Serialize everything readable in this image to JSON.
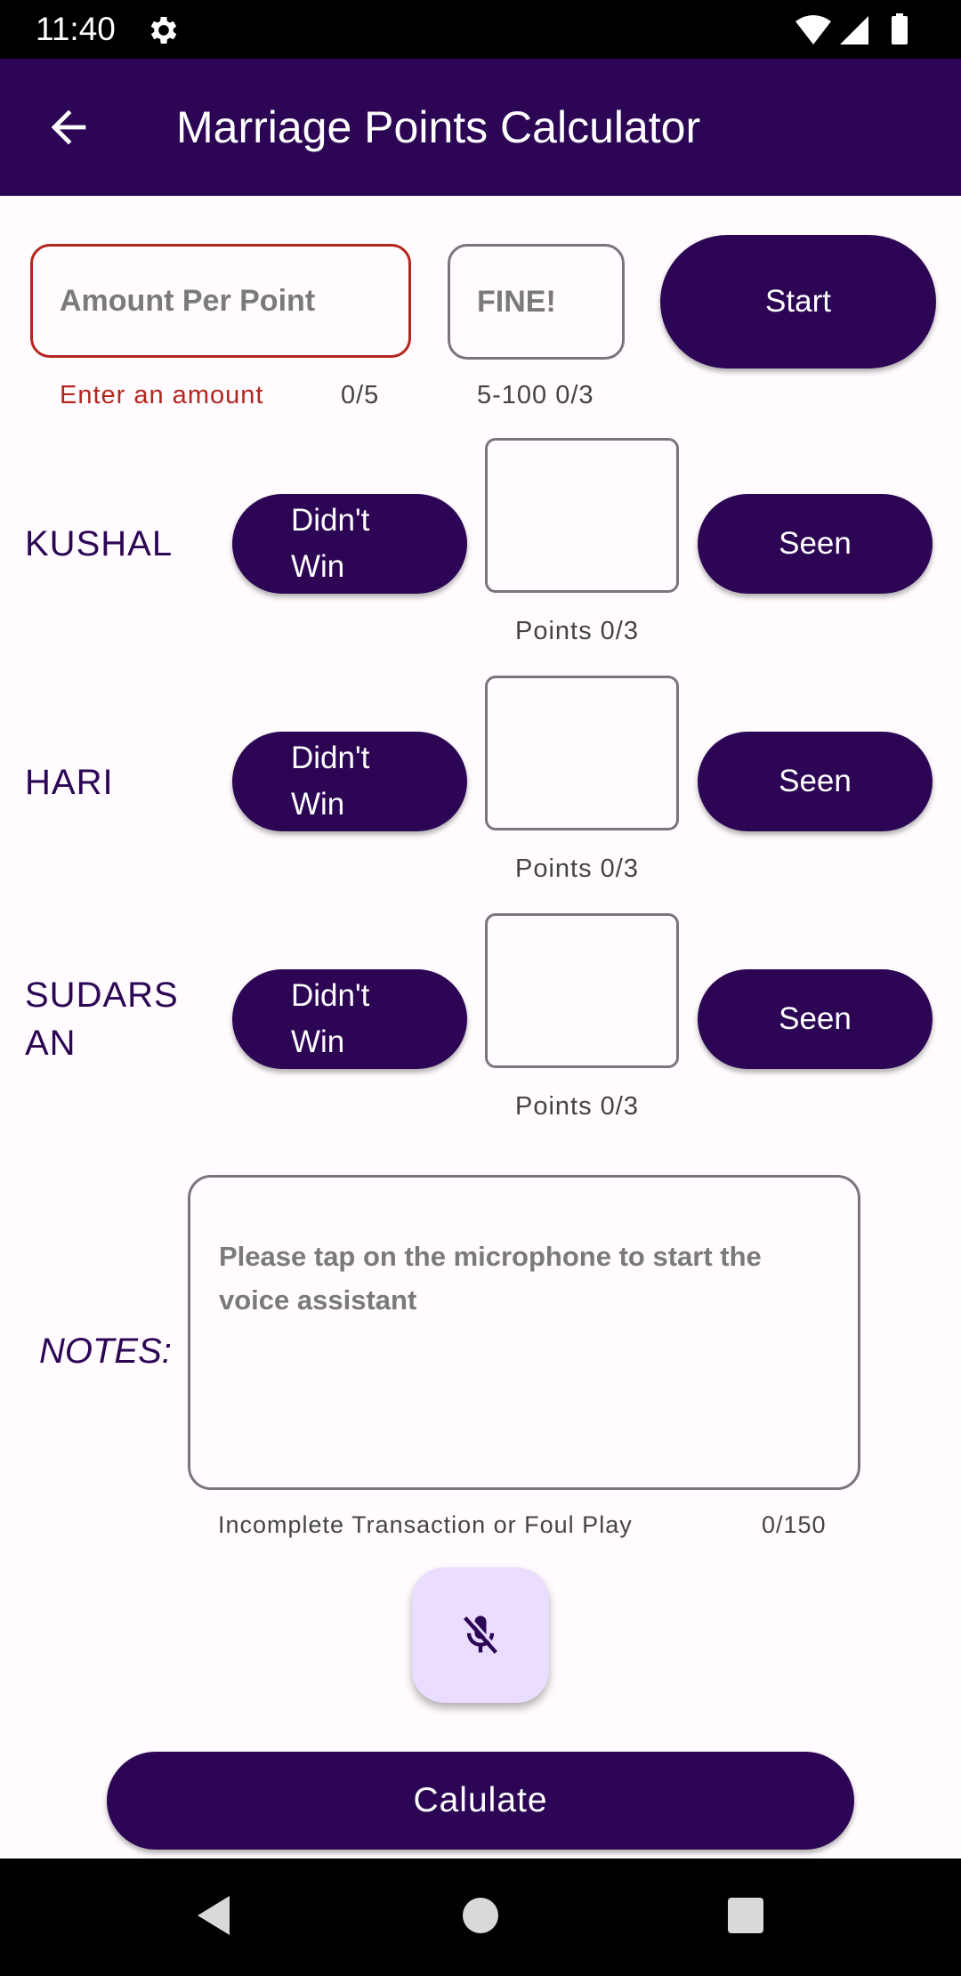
{
  "status_bar": {
    "time": "11:40"
  },
  "app_bar": {
    "title": "Marriage Points Calculator"
  },
  "amount_field": {
    "placeholder": "Amount Per Point",
    "error": "Enter an amount",
    "counter": "0/5"
  },
  "fine_field": {
    "placeholder": "FINE!",
    "helper": "5-100 0/3"
  },
  "start_button": {
    "label": "Start"
  },
  "players": [
    {
      "name": "KUSHAL",
      "didnt_win": "Didn't Win",
      "points_helper": "Points 0/3",
      "seen": "Seen"
    },
    {
      "name": "HARI",
      "didnt_win": "Didn't Win",
      "points_helper": "Points 0/3",
      "seen": "Seen"
    },
    {
      "name": "SUDARSAN",
      "didnt_win": "Didn't Win",
      "points_helper": "Points 0/3",
      "seen": "Seen"
    }
  ],
  "notes": {
    "label": "NOTES:",
    "placeholder": "Please tap on the microphone to start the voice assistant",
    "helper": "Incomplete Transaction or Foul Play",
    "counter": "0/150"
  },
  "mic_button": {
    "icon": "mic-off-icon"
  },
  "calculate_button": {
    "label": "Calulate"
  },
  "colors": {
    "primary": "#2c0654",
    "error": "#b3261e",
    "fab_bg": "#eaddff",
    "background": "#fffbfe"
  }
}
